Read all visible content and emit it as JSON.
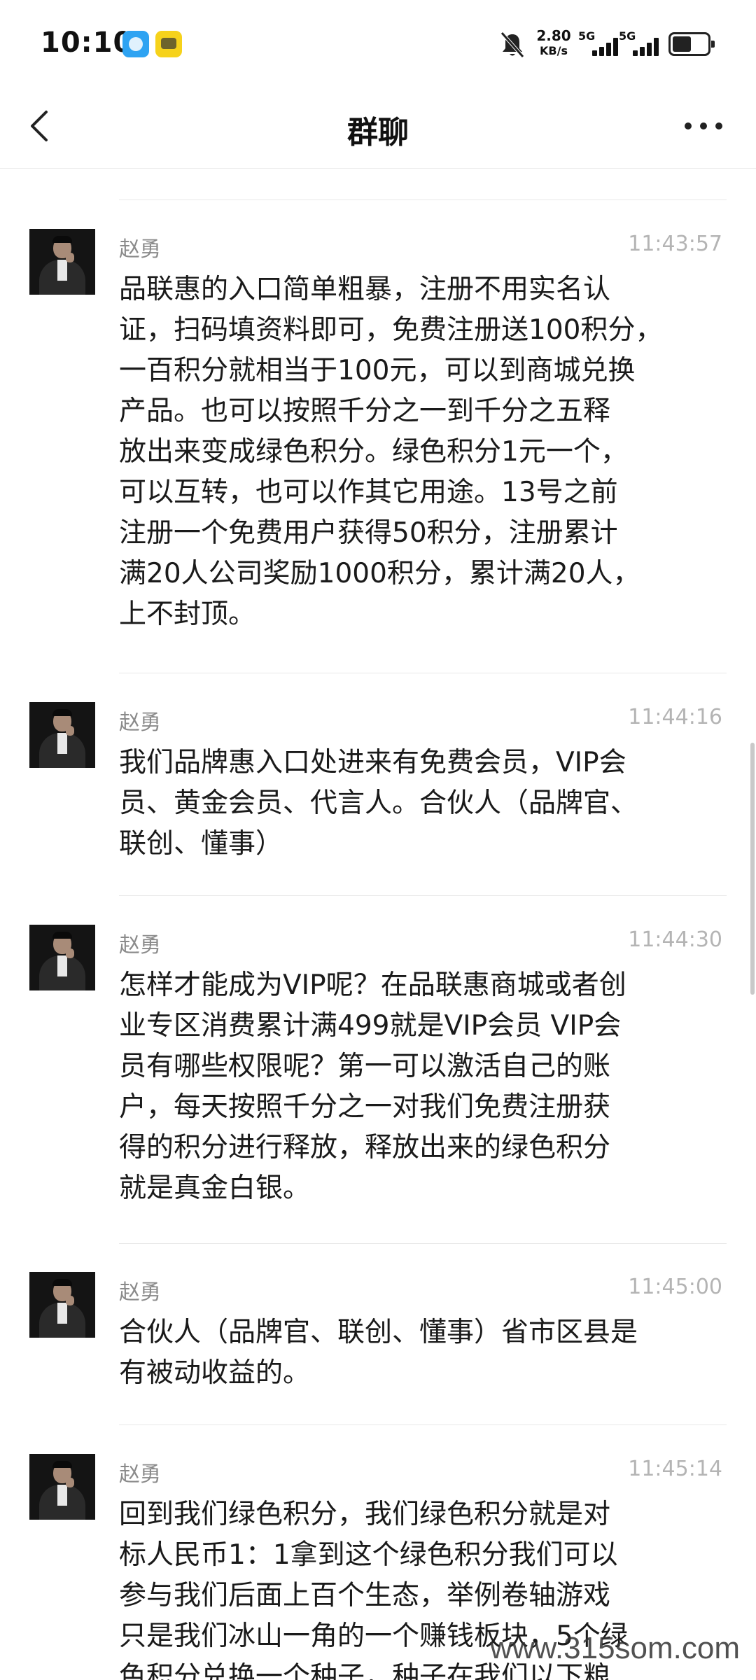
{
  "status_bar": {
    "time": "10:10",
    "net_speed_value": "2.80",
    "net_speed_unit": "KB/s",
    "signal_1": "5G",
    "signal_2": "5G",
    "battery_level_percent": 55,
    "icons": [
      "app-notification-icon",
      "app-notification-icon-2",
      "mute-bell-icon",
      "battery-icon"
    ]
  },
  "nav": {
    "title": "群聊",
    "back_icon": "chevron-left-icon",
    "more_icon": "more-dots-icon"
  },
  "messages": [
    {
      "sender": "赵勇",
      "time": "11:43:57",
      "text": "品联惠的入口简单粗暴，注册不用实名认\n证，扫码填资料即可，免费注册送100积分，\n一百积分就相当于100元，可以到商城兑换\n产品。也可以按照千分之一到千分之五释\n放出来变成绿色积分。绿色积分1元一个，\n可以互转，也可以作其它用途。13号之前\n注册一个免费用户获得50积分，注册累计\n满20人公司奖励1000积分，累计满20人，\n上不封顶。"
    },
    {
      "sender": "赵勇",
      "time": "11:44:16",
      "text": "我们品牌惠入口处进来有免费会员，VIP会\n员、黄金会员、代言人。合伙人（品牌官、\n联创、懂事）"
    },
    {
      "sender": "赵勇",
      "time": "11:44:30",
      "text": "怎样才能成为VIP呢？在品联惠商城或者创\n业专区消费累计满499就是VIP会员 VIP会\n员有哪些权限呢？第一可以激活自己的账\n户，每天按照千分之一对我们免费注册获\n得的积分进行释放，释放出来的绿色积分\n就是真金白银。"
    },
    {
      "sender": "赵勇",
      "time": "11:45:00",
      "text": "合伙人（品牌官、联创、懂事）省市区县是\n有被动收益的。"
    },
    {
      "sender": "赵勇",
      "time": "11:45:14",
      "text": "回到我们绿色积分，我们绿色积分就是对\n标人民币1：1拿到这个绿色积分我们可以\n参与我们后面上百个生态，举例卷轴游戏\n只是我们冰山一角的一个赚钱板块，5个绿\n色积分兑换一个种子，种子在我们以下粮"
    }
  ],
  "watermark": "www.315som.com"
}
